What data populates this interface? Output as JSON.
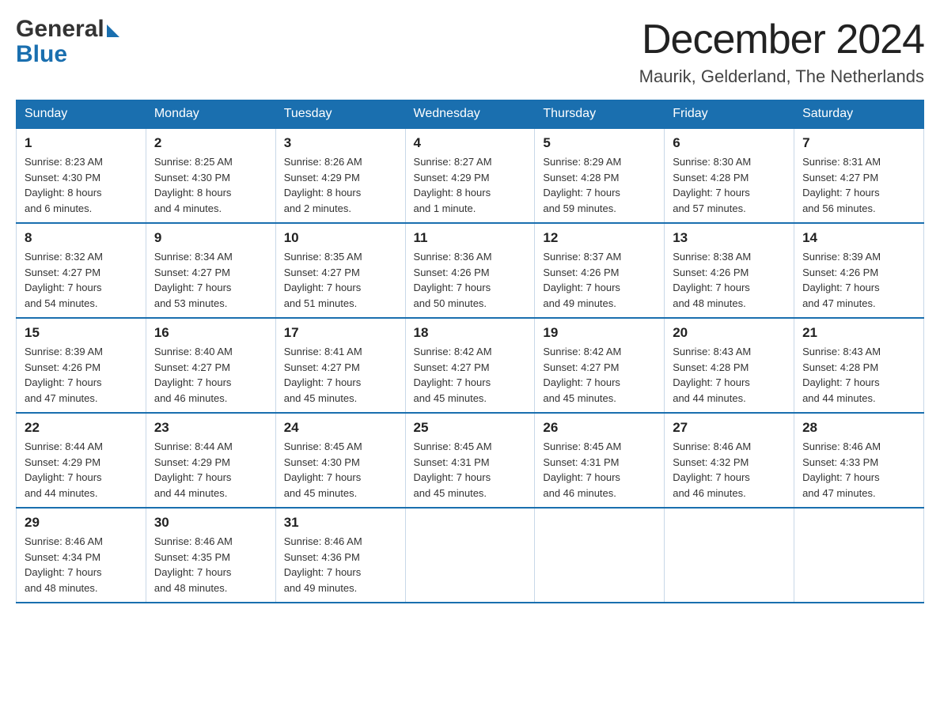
{
  "logo": {
    "general": "General",
    "blue": "Blue"
  },
  "header": {
    "title": "December 2024",
    "subtitle": "Maurik, Gelderland, The Netherlands"
  },
  "weekdays": [
    "Sunday",
    "Monday",
    "Tuesday",
    "Wednesday",
    "Thursday",
    "Friday",
    "Saturday"
  ],
  "weeks": [
    [
      {
        "day": "1",
        "sunrise": "8:23 AM",
        "sunset": "4:30 PM",
        "daylight": "8 hours and 6 minutes."
      },
      {
        "day": "2",
        "sunrise": "8:25 AM",
        "sunset": "4:30 PM",
        "daylight": "8 hours and 4 minutes."
      },
      {
        "day": "3",
        "sunrise": "8:26 AM",
        "sunset": "4:29 PM",
        "daylight": "8 hours and 2 minutes."
      },
      {
        "day": "4",
        "sunrise": "8:27 AM",
        "sunset": "4:29 PM",
        "daylight": "8 hours and 1 minute."
      },
      {
        "day": "5",
        "sunrise": "8:29 AM",
        "sunset": "4:28 PM",
        "daylight": "7 hours and 59 minutes."
      },
      {
        "day": "6",
        "sunrise": "8:30 AM",
        "sunset": "4:28 PM",
        "daylight": "7 hours and 57 minutes."
      },
      {
        "day": "7",
        "sunrise": "8:31 AM",
        "sunset": "4:27 PM",
        "daylight": "7 hours and 56 minutes."
      }
    ],
    [
      {
        "day": "8",
        "sunrise": "8:32 AM",
        "sunset": "4:27 PM",
        "daylight": "7 hours and 54 minutes."
      },
      {
        "day": "9",
        "sunrise": "8:34 AM",
        "sunset": "4:27 PM",
        "daylight": "7 hours and 53 minutes."
      },
      {
        "day": "10",
        "sunrise": "8:35 AM",
        "sunset": "4:27 PM",
        "daylight": "7 hours and 51 minutes."
      },
      {
        "day": "11",
        "sunrise": "8:36 AM",
        "sunset": "4:26 PM",
        "daylight": "7 hours and 50 minutes."
      },
      {
        "day": "12",
        "sunrise": "8:37 AM",
        "sunset": "4:26 PM",
        "daylight": "7 hours and 49 minutes."
      },
      {
        "day": "13",
        "sunrise": "8:38 AM",
        "sunset": "4:26 PM",
        "daylight": "7 hours and 48 minutes."
      },
      {
        "day": "14",
        "sunrise": "8:39 AM",
        "sunset": "4:26 PM",
        "daylight": "7 hours and 47 minutes."
      }
    ],
    [
      {
        "day": "15",
        "sunrise": "8:39 AM",
        "sunset": "4:26 PM",
        "daylight": "7 hours and 47 minutes."
      },
      {
        "day": "16",
        "sunrise": "8:40 AM",
        "sunset": "4:27 PM",
        "daylight": "7 hours and 46 minutes."
      },
      {
        "day": "17",
        "sunrise": "8:41 AM",
        "sunset": "4:27 PM",
        "daylight": "7 hours and 45 minutes."
      },
      {
        "day": "18",
        "sunrise": "8:42 AM",
        "sunset": "4:27 PM",
        "daylight": "7 hours and 45 minutes."
      },
      {
        "day": "19",
        "sunrise": "8:42 AM",
        "sunset": "4:27 PM",
        "daylight": "7 hours and 45 minutes."
      },
      {
        "day": "20",
        "sunrise": "8:43 AM",
        "sunset": "4:28 PM",
        "daylight": "7 hours and 44 minutes."
      },
      {
        "day": "21",
        "sunrise": "8:43 AM",
        "sunset": "4:28 PM",
        "daylight": "7 hours and 44 minutes."
      }
    ],
    [
      {
        "day": "22",
        "sunrise": "8:44 AM",
        "sunset": "4:29 PM",
        "daylight": "7 hours and 44 minutes."
      },
      {
        "day": "23",
        "sunrise": "8:44 AM",
        "sunset": "4:29 PM",
        "daylight": "7 hours and 44 minutes."
      },
      {
        "day": "24",
        "sunrise": "8:45 AM",
        "sunset": "4:30 PM",
        "daylight": "7 hours and 45 minutes."
      },
      {
        "day": "25",
        "sunrise": "8:45 AM",
        "sunset": "4:31 PM",
        "daylight": "7 hours and 45 minutes."
      },
      {
        "day": "26",
        "sunrise": "8:45 AM",
        "sunset": "4:31 PM",
        "daylight": "7 hours and 46 minutes."
      },
      {
        "day": "27",
        "sunrise": "8:46 AM",
        "sunset": "4:32 PM",
        "daylight": "7 hours and 46 minutes."
      },
      {
        "day": "28",
        "sunrise": "8:46 AM",
        "sunset": "4:33 PM",
        "daylight": "7 hours and 47 minutes."
      }
    ],
    [
      {
        "day": "29",
        "sunrise": "8:46 AM",
        "sunset": "4:34 PM",
        "daylight": "7 hours and 48 minutes."
      },
      {
        "day": "30",
        "sunrise": "8:46 AM",
        "sunset": "4:35 PM",
        "daylight": "7 hours and 48 minutes."
      },
      {
        "day": "31",
        "sunrise": "8:46 AM",
        "sunset": "4:36 PM",
        "daylight": "7 hours and 49 minutes."
      },
      null,
      null,
      null,
      null
    ]
  ],
  "labels": {
    "sunrise": "Sunrise:",
    "sunset": "Sunset:",
    "daylight": "Daylight:"
  }
}
